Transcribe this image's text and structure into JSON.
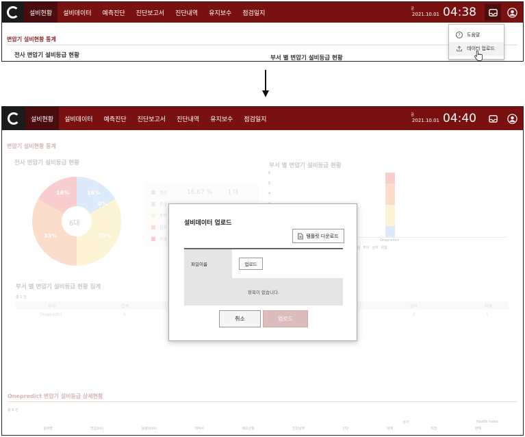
{
  "top": {
    "menu": [
      "설비현황",
      "설비데이터",
      "예측진단",
      "진단보고서",
      "진단내역",
      "유지보수",
      "점검일지"
    ],
    "date": "2021.10.01",
    "day": "금",
    "time": "04:38",
    "section_title": "변압기 설비현황 통계",
    "left_subtitle": "전사 변압기 설비등급 현황",
    "right_subtitle": "부서 별 변압기 설비등급 현황",
    "dropdown": {
      "help": "도움말",
      "upload": "데이터 업로드"
    }
  },
  "bottom": {
    "menu": [
      "설비현황",
      "설비데이터",
      "예측진단",
      "진단보고서",
      "진단내역",
      "유지보수",
      "점검일지"
    ],
    "date": "2021.10.01",
    "day": "금",
    "time": "04:40",
    "section_title": "변압기 설비현황 통계",
    "pie_title": "전사 변압기 설비등급 현황",
    "bar_title": "부서 별 변압기 설비등급 현황",
    "pie_center": "6대",
    "pie_labels": {
      "p1": "16%",
      "p2": "0%",
      "p3": "33%",
      "p4": "33%",
      "p5": "16%"
    },
    "legend": [
      {
        "label": "정상",
        "color": "#9ec5ee"
      },
      {
        "label": "관심",
        "color": "#a8d8a0"
      },
      {
        "label": "주의",
        "color": "#f7e08a"
      },
      {
        "label": "심각",
        "color": "#f5a070"
      },
      {
        "label": "위험",
        "color": "#ee7373"
      }
    ],
    "legend_pct": "16.67 %",
    "legend_cnt": "1 대",
    "bar_y_ticks": [
      "6",
      "5",
      "4",
      "3"
    ],
    "bar_x_label": "Onepredict",
    "bar_legend": [
      "관심",
      "주의",
      "심각",
      "위험"
    ],
    "summary_title": "부서 별 변압기 설비등급 현황 집계",
    "summary_count": "총 1 건",
    "summary_headers": {
      "dept": "부서",
      "total": "합계",
      "severe": "심각",
      "danger": "위험"
    },
    "summary_row": {
      "dept": "Onepredict",
      "total": "6",
      "severe": "2",
      "danger": "1"
    },
    "detail_title": "Onepredict 변압기 설비등급 상세현황",
    "detail_count": "총 6 건",
    "detail_headers": [
      "설비명",
      "전압(kV)",
      "용량(kVA)",
      "제작사",
      "제조년월",
      "진단날짜",
      "진단",
      "현재",
      "직전",
      "현재"
    ],
    "detail_group1": "심각",
    "detail_group2": "Health Index",
    "modal": {
      "title": "설비데이터 업로드",
      "template_btn": "템플릿 다운로드",
      "file_label": "파일이름",
      "upload_btn": "업로드",
      "empty": "항목이 없습니다.",
      "cancel": "취소",
      "submit": "업로드"
    }
  }
}
